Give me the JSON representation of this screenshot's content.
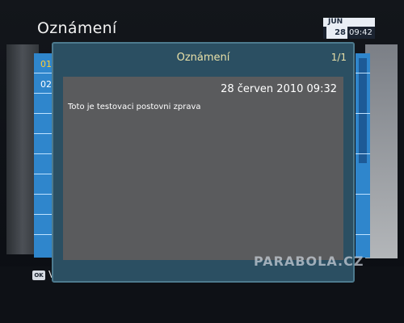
{
  "header": {
    "title": "Oznámení"
  },
  "clock": {
    "month": "JUN",
    "day": "28",
    "time": "09:42"
  },
  "background_list": {
    "numbers": [
      "01",
      "02"
    ]
  },
  "dialog": {
    "title": "Oznámení",
    "page_indicator": "1/1",
    "message": {
      "date": "28 červen 2010  09:32",
      "text": "Toto je testovaci postovni zprava"
    }
  },
  "footer": {
    "ok_key": "OK",
    "ok_label": "V"
  },
  "watermark": "PARABOLA.CZ",
  "colors": {
    "dialog_bg": "#2b4f62",
    "message_bg": "#5a5b5d",
    "list_blue": "#2f86cc",
    "title_yellow": "#e8e0a8"
  }
}
